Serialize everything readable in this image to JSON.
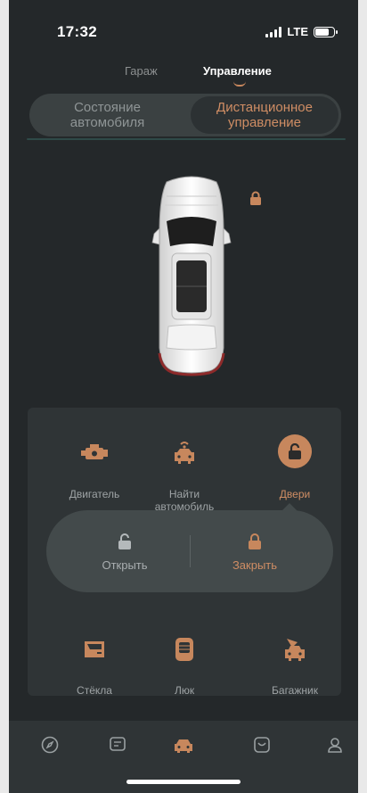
{
  "status_bar": {
    "time": "17:32",
    "network": "LTE"
  },
  "top_tabs": {
    "garage": "Гараж",
    "control": "Управление"
  },
  "segment": {
    "state": "Состояние\nавтомобиля",
    "remote": "Дистанционное\nуправление"
  },
  "controls": {
    "engine": "Двигатель",
    "find_car": "Найти\nавтомобиль",
    "doors": "Двери",
    "windows": "Стёкла",
    "sunroof": "Люк",
    "trunk": "Багажник"
  },
  "doors_popup": {
    "open": "Открыть",
    "close": "Закрыть"
  },
  "lock_status": "locked",
  "colors": {
    "accent": "#c7875d",
    "background": "#24282a",
    "panel": "#2f3436"
  },
  "icons": {
    "nav": [
      "compass-icon",
      "messages-icon",
      "car-icon",
      "store-icon",
      "profile-icon"
    ],
    "active_nav": "car-icon"
  }
}
